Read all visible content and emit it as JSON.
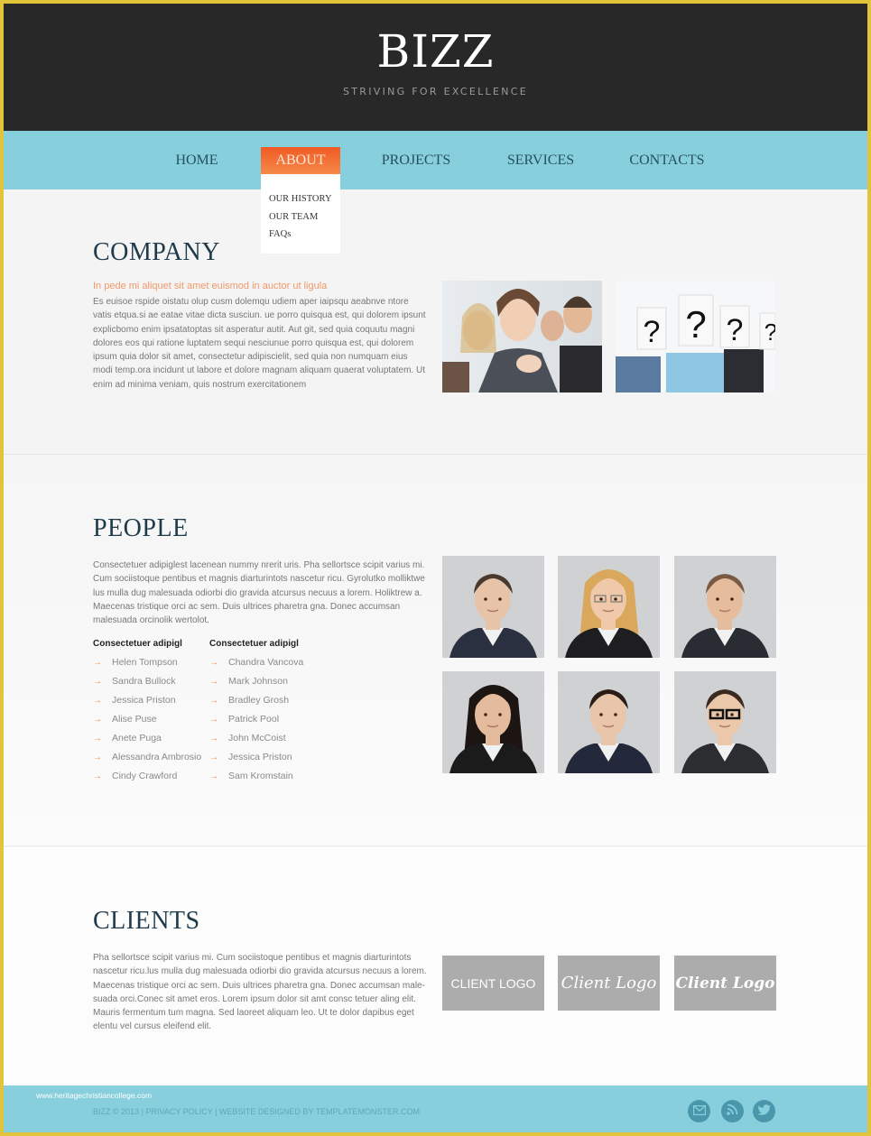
{
  "header": {
    "logo": "BIZZ",
    "tagline": "STRIVING FOR EXCELLENCE"
  },
  "nav": {
    "items": [
      {
        "label": "HOME",
        "active": false
      },
      {
        "label": "ABOUT",
        "active": true
      },
      {
        "label": "PROJECTS",
        "active": false
      },
      {
        "label": "SERVICES",
        "active": false
      },
      {
        "label": "CONTACTS",
        "active": false
      }
    ],
    "dropdown": [
      "OUR HISTORY",
      "OUR TEAM",
      "FAQs"
    ]
  },
  "company": {
    "heading": "COMPANY",
    "lead": "In pede mi aliquet sit amet euismod in auctor ut ligula",
    "body": "Es euisoe rspide oistatu olup cusm dolemqu udiem aper iaipsqu aeabnve ntore vatis etqua.si ae eatae vitae dicta susciun. ue porro quisqua est, qui dolorem ipsunt explicbomo enim ipsatatoptas sit asperatur autit. Aut git, sed quia coquutu magni dolores eos qui ratione luptatem sequi nesciunue porro quisqua est, qui dolorem ipsum quia dolor sit amet, consectetur adipiscielit, sed quia non numquam eius modi temp.ora incidunt ut labore et dolore magnam aliquam quaerat voluptatem. Ut enim ad minima veniam, quis nostrum exercitationem",
    "images": [
      "team-applauding-photo",
      "question-mark-signs-photo"
    ]
  },
  "people": {
    "heading": "PEOPLE",
    "body": "Consectetuer adipiglest lacenean nummy nrerit uris. Pha sellortsce scipit varius mi. Cum sociistoque pentibus et magnis diarturintots nascetur ricu. Gyrolutko molliktwe lus mulla dug malesuada odiorbi dio gravida atcursus necuus a lorem. Holiktrew a. Maecenas tristique orci ac sem. Duis ultrices pharetra gna. Donec accumsan malesuada orcinolik wertolot.",
    "lists": [
      {
        "title": "Consectetuer adipigl",
        "items": [
          "Helen Tompson",
          "Sandra Bullock",
          "Jessica Priston",
          "Alise Puse",
          "Anete Puga",
          "Alessandra Ambrosio",
          "Cindy Crawford"
        ]
      },
      {
        "title": "Consectetuer adipigl",
        "items": [
          "Chandra Vancova",
          "Mark Johnson",
          "Bradley Grosh",
          "Patrick Pool",
          "John McCoist",
          "Jessica Priston",
          "Sam Kromstain"
        ]
      }
    ],
    "list_arrow": "→",
    "portraits": [
      "portrait-1",
      "portrait-2",
      "portrait-3",
      "portrait-4",
      "portrait-5",
      "portrait-6"
    ]
  },
  "clients": {
    "heading": "CLIENTS",
    "body": "Pha sellortsce scipit varius mi. Cum sociistoque pentibus et magnis diarturintots nascetur ricu.lus mulla dug malesuada odiorbi dio gravida atcursus necuus a lorem. Maecenas tristique orci ac sem. Duis ultrices pharetra gna. Donec accumsan male-suada orci.Conec sit amet eros. Lorem ipsum dolor sit amt consc tetuer aling elit. Mauris fermentum tum magna. Sed laoreet aliquam leo. Ut te dolor dapibus eget elentu vel cursus eleifend elit.",
    "logos": [
      "CLIENT LOGO",
      "Client Logo",
      "Client Logo"
    ]
  },
  "footer": {
    "watermark": "www.heritagechristiancollege.com",
    "copyright": "BIZZ © 2013 |",
    "privacy": "PRIVACY POLICY",
    "sep": "|",
    "credit": "WEBSITE  DESIGNED BY TEMPLATEMONSTER.COM",
    "social": [
      "mail-icon",
      "rss-icon",
      "twitter-icon"
    ]
  },
  "colors": {
    "accent": "#f15a24",
    "nav_bg": "#87cfdc",
    "header_bg": "#282828",
    "heading": "#1f3a4a",
    "social_icon": "#4a96aa"
  }
}
